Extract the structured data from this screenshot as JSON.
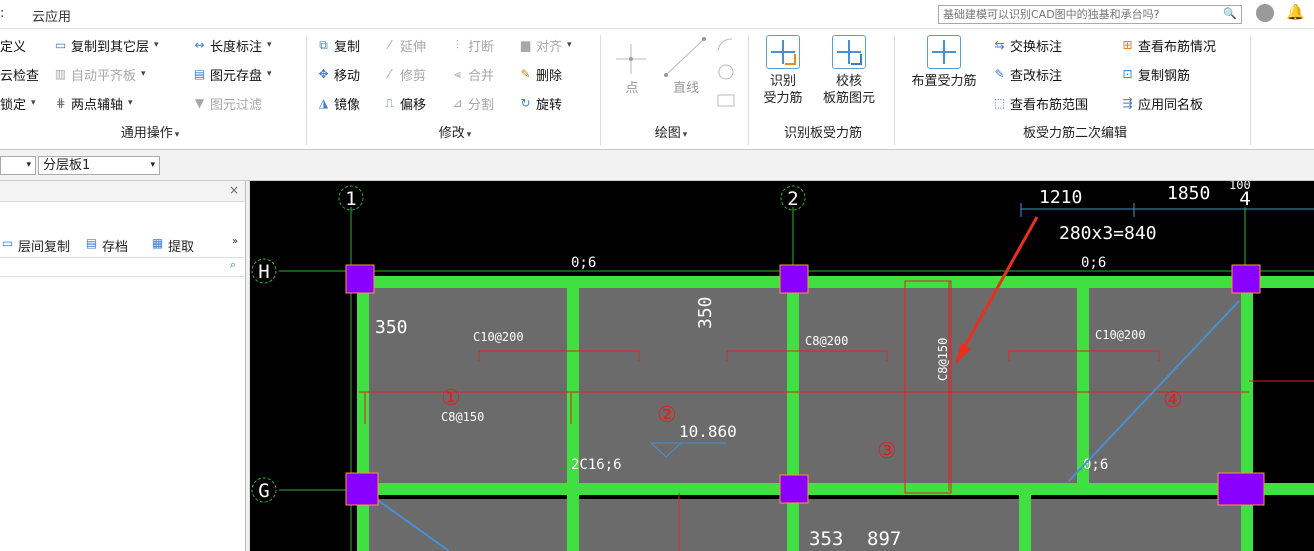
{
  "menu": {
    "items": [
      "云应用"
    ],
    "search_placeholder": "基础建模可以识别CAD图中的独基和承台吗?"
  },
  "ribbon": {
    "common_ops": {
      "buttons": [
        "定义",
        "云检查",
        "锁定",
        "复制到其它层",
        "自动平齐板",
        "两点辅轴",
        "长度标注",
        "图元存盘",
        "图元过滤"
      ],
      "label": "通用操作"
    },
    "modify": {
      "buttons": [
        "复制",
        "延伸",
        "打断",
        "对齐",
        "移动",
        "修剪",
        "合并",
        "删除",
        "镜像",
        "偏移",
        "分割",
        "旋转"
      ],
      "label": "修改"
    },
    "draw": {
      "buttons": [
        "点",
        "直线"
      ],
      "label": "绘图"
    },
    "recognize": {
      "buttons": [
        "识别\n受力筋",
        "校核\n板筋图元"
      ],
      "label": "识别板受力筋"
    },
    "edit": {
      "big_button": "布置受力筋",
      "buttons": [
        "交换标注",
        "查看布筋情况",
        "查改标注",
        "复制钢筋",
        "查看布筋范围",
        "应用同名板"
      ],
      "label": "板受力筋二次编辑"
    }
  },
  "toolbar2": {
    "layer": "分层板1"
  },
  "panel": {
    "tools": [
      "层间复制",
      "存档",
      "提取"
    ]
  },
  "canvas": {
    "axis_labels": [
      "1",
      "2",
      "4",
      "H",
      "G"
    ],
    "dims": [
      "1210",
      "1850",
      "100",
      "280x3=840",
      "350",
      "350",
      "353",
      "897",
      "10.860"
    ],
    "rebar_labels": [
      "0;6",
      "0;6",
      "0;6",
      "2C16;6",
      "C10@200",
      "C8@200",
      "C10@200",
      "C8@150",
      "C8@150"
    ],
    "region_markers": [
      "①",
      "②",
      "③",
      "④"
    ]
  },
  "colors": {
    "canvas_bg": "#000000",
    "slab": "#6b6b6b",
    "beam": "#3fe03f",
    "column": "#8a00ff",
    "rebar": "#e02020",
    "arrow": "#e83020"
  }
}
